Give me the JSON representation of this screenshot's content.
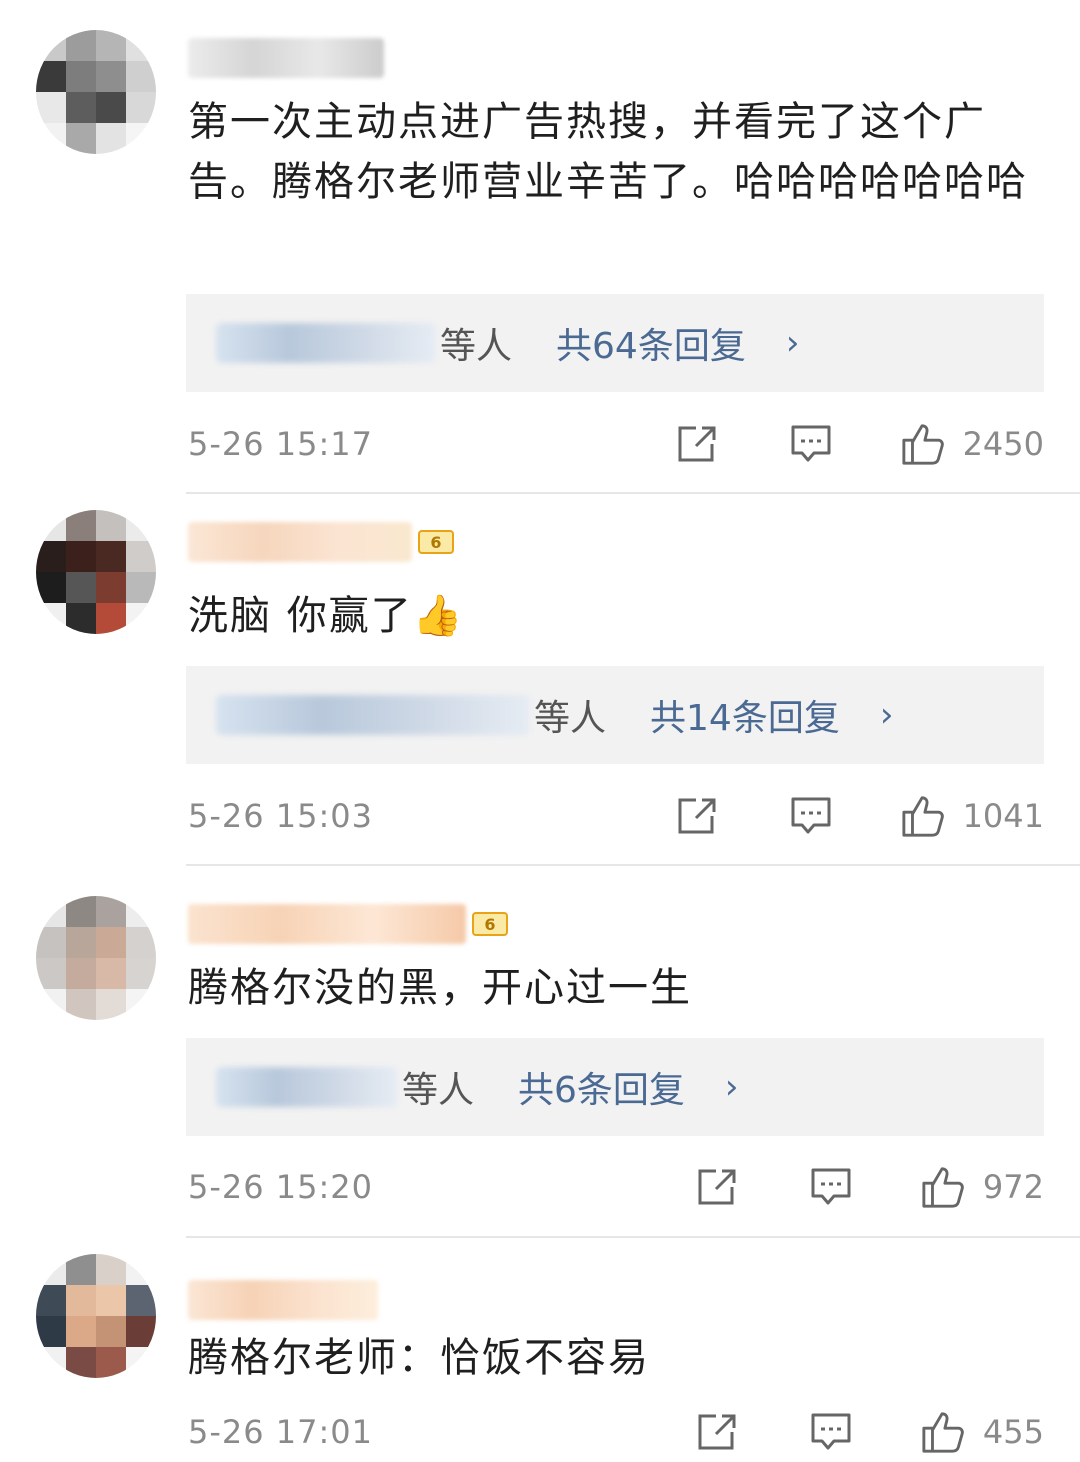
{
  "comments": [
    {
      "text": "第一次主动点进广告热搜，并看完了这个广告。腾格尔老师营业辛苦了。哈哈哈哈哈哈哈",
      "replies_suffix": "等人",
      "replies_count": "共64条回复",
      "time": "5-26  15:17",
      "likes": "2450"
    },
    {
      "text": "洗脑  你赢了👍",
      "replies_suffix": "等人",
      "replies_count": "共14条回复",
      "time": "5-26  15:03",
      "likes": "1041",
      "level_badge": "6"
    },
    {
      "text": "腾格尔没的黑，开心过一生",
      "replies_suffix": "等人",
      "replies_count": "共6条回复",
      "time": "5-26  15:20",
      "likes": "972",
      "level_badge": "6"
    },
    {
      "text": "腾格尔老师：恰饭不容易",
      "time": "5-26  17:01",
      "likes": "455"
    }
  ],
  "chevron": "›",
  "colors": {
    "link": "#4b6a93",
    "meta": "#8a8a8a",
    "reply_bg": "#f2f2f2",
    "divider": "#e6e6e6"
  },
  "icons": {
    "share": "share-icon",
    "comment": "comment-icon",
    "like": "thumbs-up-icon"
  }
}
